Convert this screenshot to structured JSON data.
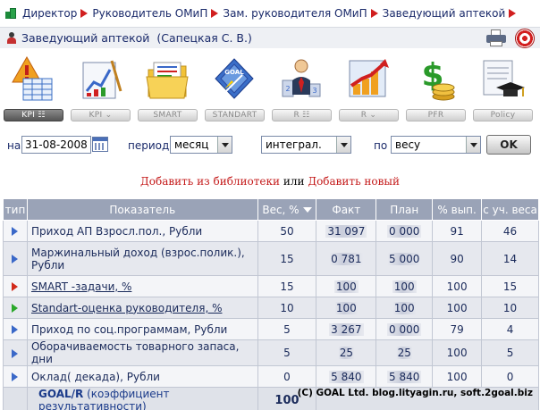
{
  "breadcrumb": [
    "Директор",
    "Руководитель ОМиП",
    "Зам. руководителя ОМиП",
    "Заведующий аптекой"
  ],
  "user": {
    "label": "Заведующий аптекой",
    "name": "(Сапецкая С. В.)"
  },
  "toolbar": [
    {
      "label": "KPI ☷",
      "icon": "kpi-table-icon",
      "active": true
    },
    {
      "label": "KPI ⌄",
      "icon": "kpi-chart-icon",
      "active": false
    },
    {
      "label": "SMART",
      "icon": "folder-icon",
      "active": false
    },
    {
      "label": "STANDART",
      "icon": "goal-compass-icon",
      "active": false
    },
    {
      "label": "R ☷",
      "icon": "ranking-icon",
      "active": false
    },
    {
      "label": "R ⌄",
      "icon": "growth-chart-icon",
      "active": false
    },
    {
      "label": "PFR",
      "icon": "money-icon",
      "active": false
    },
    {
      "label": "Policy",
      "icon": "graduation-scroll-icon",
      "active": false
    }
  ],
  "filters": {
    "date_label": "на",
    "date_value": "31-08-2008",
    "period_label": "период",
    "period_value": "месяц",
    "mode_value": "интеграл.",
    "by_label": "по",
    "by_value": "весу",
    "ok_label": "OK"
  },
  "links": {
    "add_library": "Добавить из библиотеки",
    "or": "или",
    "add_new": "Добавить новый"
  },
  "table": {
    "headers": [
      "тип",
      "Показатель",
      "Вес, %",
      "Факт",
      "План",
      "% вып.",
      "с уч. веса"
    ],
    "rows": [
      {
        "type_color": "#3a68c8",
        "name": "Приход АП Взросл.пол., Рубли",
        "weight": "50",
        "fact": "31 097",
        "plan": "0 000",
        "pct": "91",
        "weighted": "46",
        "link": false
      },
      {
        "type_color": "#3a68c8",
        "name": "Маржинальный доход (взрос.полик.), Рубли",
        "weight": "15",
        "fact": "0 781",
        "plan": "5 000",
        "pct": "90",
        "weighted": "14",
        "link": false
      },
      {
        "type_color": "#d22a1a",
        "name": "SMART -задачи, %",
        "weight": "15",
        "fact": "100",
        "plan": "100",
        "pct": "100",
        "weighted": "15",
        "link": true
      },
      {
        "type_color": "#2aa82a",
        "name": "Standart-оценка руководителя, %",
        "weight": "10",
        "fact": "100",
        "plan": "100",
        "pct": "100",
        "weighted": "10",
        "link": true
      },
      {
        "type_color": "#3a68c8",
        "name": "Приход по соц.программам, Рубли",
        "weight": "5",
        "fact": "3 267",
        "plan": "0 000",
        "pct": "79",
        "weighted": "4",
        "link": false
      },
      {
        "type_color": "#3a68c8",
        "name": "Оборачиваемость товарного запаса, дни",
        "weight": "5",
        "fact": "25",
        "plan": "25",
        "pct": "100",
        "weighted": "5",
        "link": false
      },
      {
        "type_color": "#3a68c8",
        "name": "Оклад( декада), Рубли",
        "weight": "0",
        "fact": "5 840",
        "plan": "5 840",
        "pct": "100",
        "weighted": "0",
        "link": false
      }
    ],
    "total": {
      "goal": "GOAL/R",
      "coef": "(коэффициент результативности)",
      "weight": "100"
    }
  },
  "copyright": "(C) GOAL Ltd. blog.lityagin.ru, soft.2goal.biz"
}
